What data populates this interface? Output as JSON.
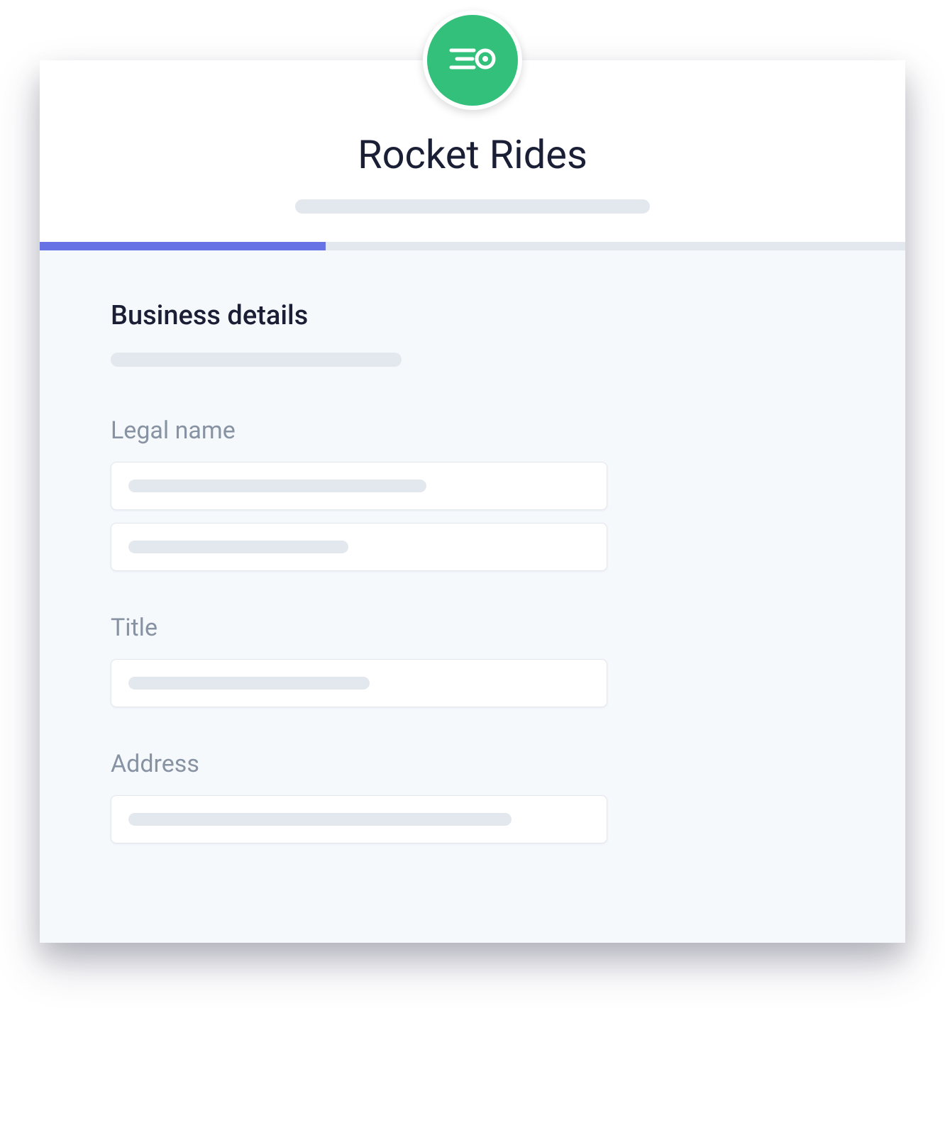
{
  "header": {
    "app_title": "Rocket Rides",
    "logo_icon": "rocket-motion-icon"
  },
  "progress": {
    "percent": 33
  },
  "form": {
    "section_title": "Business details",
    "fields": [
      {
        "label": "Legal name",
        "inputs": [
          {
            "value": "",
            "placeholder_width": "w-420"
          },
          {
            "value": "",
            "placeholder_width": "w-310"
          }
        ]
      },
      {
        "label": "Title",
        "inputs": [
          {
            "value": "",
            "placeholder_width": "w-340"
          }
        ]
      },
      {
        "label": "Address",
        "inputs": [
          {
            "value": "",
            "placeholder_width": "w-540"
          }
        ]
      }
    ]
  },
  "colors": {
    "brand_green": "#32c07a",
    "accent_purple": "#6772e5",
    "text_dark": "#1a1f36",
    "text_muted": "#8792a2",
    "placeholder_bg": "#e3e8ee",
    "body_bg": "#f6f9fc"
  }
}
